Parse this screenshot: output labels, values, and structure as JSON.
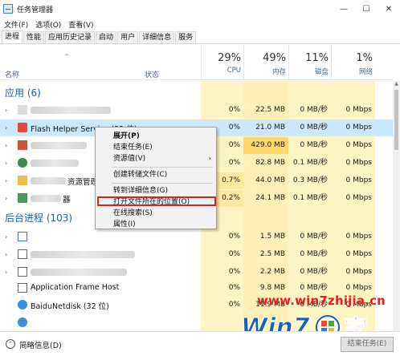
{
  "window": {
    "title": "任务管理器",
    "minimize": "—",
    "maximize": "☐",
    "close": "✕"
  },
  "menu": [
    "文件(F)",
    "选项(O)",
    "查看(V)"
  ],
  "tabs": [
    "进程",
    "性能",
    "应用历史记录",
    "启动",
    "用户",
    "详细信息",
    "服务"
  ],
  "header": {
    "sort_arrow": "^",
    "name": "名称",
    "status": "状态",
    "cpu": {
      "pct": "29%",
      "label": "CPU"
    },
    "mem": {
      "pct": "49%",
      "label": "内存"
    },
    "disk": {
      "pct": "11%",
      "label": "磁盘"
    },
    "net": {
      "pct": "1%",
      "label": "网络"
    }
  },
  "groups": {
    "apps": "应用 (6)",
    "background": "后台进程 (103)"
  },
  "rows": {
    "r0": {
      "cpu": "0%",
      "mem": "22.5 MB",
      "disk": "0 MB/秒",
      "net": "0 Mbps"
    },
    "r1": {
      "name": "Flash Helper Service (32 位)",
      "cpu": "0%",
      "mem": "21.0 MB",
      "disk": "0 MB/秒",
      "net": "0 Mbps"
    },
    "r2": {
      "cpu": "0%",
      "mem": "429.0 MB",
      "disk": "0 MB/秒",
      "net": "0 Mbps"
    },
    "r3": {
      "cpu": "0%",
      "mem": "82.8 MB",
      "disk": "0.1 MB/秒",
      "net": "0 Mbps"
    },
    "r4": {
      "name": "资源管理器",
      "cpu": "0.7%",
      "mem": "44.0 MB",
      "disk": "0.3 MB/秒",
      "net": "0 Mbps"
    },
    "r5": {
      "name": "器",
      "cpu": "0.2%",
      "mem": "24.1 MB",
      "disk": "0.1 MB/秒",
      "net": "0 Mbps"
    },
    "b0": {
      "cpu": "0%",
      "mem": "1.5 MB",
      "disk": "0 MB/秒",
      "net": "0 Mbps"
    },
    "b1": {
      "cpu": "0%",
      "mem": "2.5 MB",
      "disk": "0 MB/秒",
      "net": "0 Mbps"
    },
    "b2": {
      "cpu": "0%",
      "mem": "2.2 MB",
      "disk": "0 MB/秒",
      "net": "0 Mbps"
    },
    "b3": {
      "name": "Application Frame Host",
      "cpu": "0%",
      "mem": "9.8 MB",
      "disk": "0 MB/秒",
      "net": "0 Mbps"
    },
    "b4": {
      "name": "BaiduNetdisk (32 位)",
      "cpu": "0%",
      "mem": "11.9 MB",
      "disk": "0 MB/秒",
      "net": "0 Mbps"
    }
  },
  "context_menu": {
    "expand": "展开(P)",
    "end_task": "结束任务(E)",
    "resource_values": "资源值(V)",
    "create_dump": "创建转储文件(C)",
    "go_to_details": "转到详细信息(G)",
    "open_file_location": "打开文件所在的位置(O)",
    "search_online": "在线搜索(S)",
    "properties": "属性(I)"
  },
  "statusbar": {
    "fewer_details": "简略信息(D)",
    "end_task_button": "结束任务(E)"
  },
  "watermark": {
    "url": "www.win7zhijia.cn",
    "brand": "Win7",
    "brand_suffix": "家"
  },
  "colors": {
    "accent_blue": "#1f5fa8",
    "selected_row": "#cce8ff",
    "cpu_col": "#fff4c4",
    "mem_col_high": "#ffd86b",
    "highlight_red": "#e02020"
  }
}
